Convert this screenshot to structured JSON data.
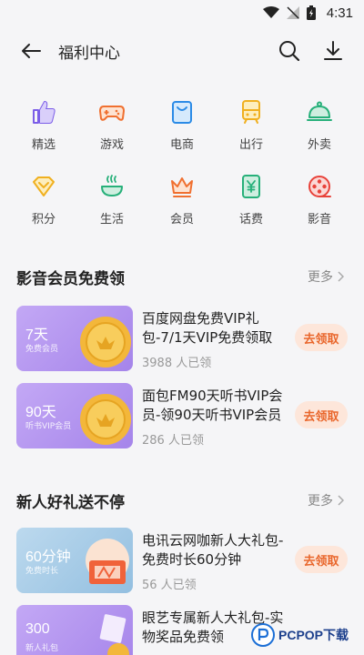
{
  "status_bar": {
    "time": "4:31",
    "icons": [
      "wifi-icon",
      "signal-icon",
      "battery-icon"
    ]
  },
  "app_bar": {
    "title": "福利中心",
    "icons": [
      "back-arrow-icon",
      "search-icon",
      "download-icon"
    ]
  },
  "categories": [
    {
      "label": "精选",
      "icon": "thumbs-up-icon",
      "color": "#7b5de8"
    },
    {
      "label": "游戏",
      "icon": "gamepad-icon",
      "color": "#f07030"
    },
    {
      "label": "电商",
      "icon": "shopping-bag-icon",
      "color": "#2b8be6"
    },
    {
      "label": "出行",
      "icon": "train-icon",
      "color": "#f0b020"
    },
    {
      "label": "外卖",
      "icon": "food-cover-icon",
      "color": "#27b07a"
    },
    {
      "label": "积分",
      "icon": "diamond-icon",
      "color": "#f0b020"
    },
    {
      "label": "生活",
      "icon": "hot-bowl-icon",
      "color": "#27b07a"
    },
    {
      "label": "会员",
      "icon": "crown-icon",
      "color": "#f07030"
    },
    {
      "label": "话费",
      "icon": "yuan-phone-icon",
      "color": "#27b07a"
    },
    {
      "label": "影音",
      "icon": "film-reel-icon",
      "color": "#e8423a"
    }
  ],
  "sections": [
    {
      "title": "影音会员免费领",
      "more": "更多",
      "items": [
        {
          "thumb_title": "7天",
          "thumb_sub": "免费会员",
          "name": "百度网盘免费VIP礼包-7/1天VIP免费领取",
          "claimed": "3988 人已领",
          "button": "去领取",
          "thumb_color": "#b79af0"
        },
        {
          "thumb_title": "90天",
          "thumb_sub": "听书VIP会员",
          "name": "面包FM90天听书VIP会员-领90天听书VIP会员",
          "claimed": "286 人已领",
          "button": "去领取",
          "thumb_color": "#b79af0"
        }
      ]
    },
    {
      "title": "新人好礼送不停",
      "more": "更多",
      "items": [
        {
          "thumb_title": "60分钟",
          "thumb_sub": "免费时长",
          "name": "电讯云网咖新人大礼包-免费时长60分钟",
          "claimed": "56 人已领",
          "button": "去领取",
          "thumb_color": "#9fc6e3"
        },
        {
          "thumb_title": "300",
          "thumb_sub": "新人礼包",
          "name": "眼艺专属新人大礼包-实物奖品免费领",
          "claimed": "",
          "button": "去领取",
          "thumb_color": "#b79af0"
        }
      ]
    }
  ],
  "watermark": {
    "text": "PCPOP下载"
  }
}
